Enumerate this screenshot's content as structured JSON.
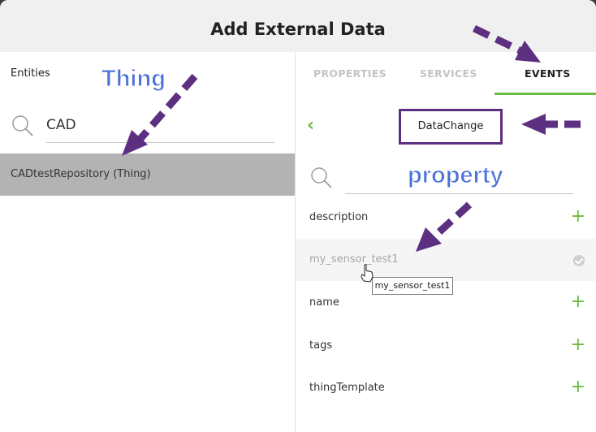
{
  "dialog": {
    "title": "Add External Data"
  },
  "left_panel": {
    "heading": "Entities",
    "search": {
      "value": "CAD",
      "icon": "search-icon"
    },
    "results": [
      {
        "label": "CADtestRepository (Thing)"
      }
    ]
  },
  "right_panel": {
    "tabs": [
      {
        "label": "PROPERTIES",
        "active": false
      },
      {
        "label": "SERVICES",
        "active": false
      },
      {
        "label": "EVENTS",
        "active": true
      }
    ],
    "back_icon": "chevron-left-icon",
    "selected_event": "DataChange",
    "filter": {
      "icon": "search-icon",
      "value": ""
    },
    "properties": [
      {
        "label": "description",
        "action": "add"
      },
      {
        "label": "my_sensor_test1",
        "action": "added"
      },
      {
        "label": "name",
        "action": "add"
      },
      {
        "label": "tags",
        "action": "add"
      },
      {
        "label": "thingTemplate",
        "action": "add"
      }
    ],
    "tooltip": "my_sensor_test1"
  },
  "annotations": {
    "thing": "Thing",
    "property": "property"
  },
  "colors": {
    "accent_green": "#6aba3e",
    "annotation_purple": "#5c2f80",
    "annotation_blue": "#4a70d9",
    "selected_row": "#b3b3b3"
  }
}
